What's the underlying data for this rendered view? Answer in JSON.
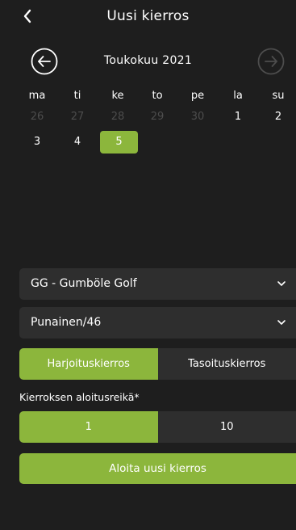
{
  "header": {
    "title": "Uusi kierros"
  },
  "calendar": {
    "month_label": "Toukokuu 2021",
    "weekdays": [
      "ma",
      "ti",
      "ke",
      "to",
      "pe",
      "la",
      "su"
    ],
    "week1": [
      "26",
      "27",
      "28",
      "29",
      "30",
      "1",
      "2"
    ],
    "week2": [
      "3",
      "4",
      "5"
    ],
    "selected_day": "5"
  },
  "course": {
    "selected": "GG - Gumböle Golf"
  },
  "tee": {
    "selected": "Punainen/46"
  },
  "round_type": {
    "options": [
      "Harjoituskierros",
      "Tasoituskierros"
    ],
    "active_index": 0
  },
  "start_hole": {
    "label": "Kierroksen aloitusreikä*",
    "options": [
      "1",
      "10"
    ],
    "active_index": 0
  },
  "start_button": {
    "label": "Aloita uusi kierros"
  },
  "colors": {
    "accent": "#8cb63c",
    "background": "#1e1e1e",
    "surface": "#2e2e2e",
    "dim_text": "#4d4d4d"
  }
}
